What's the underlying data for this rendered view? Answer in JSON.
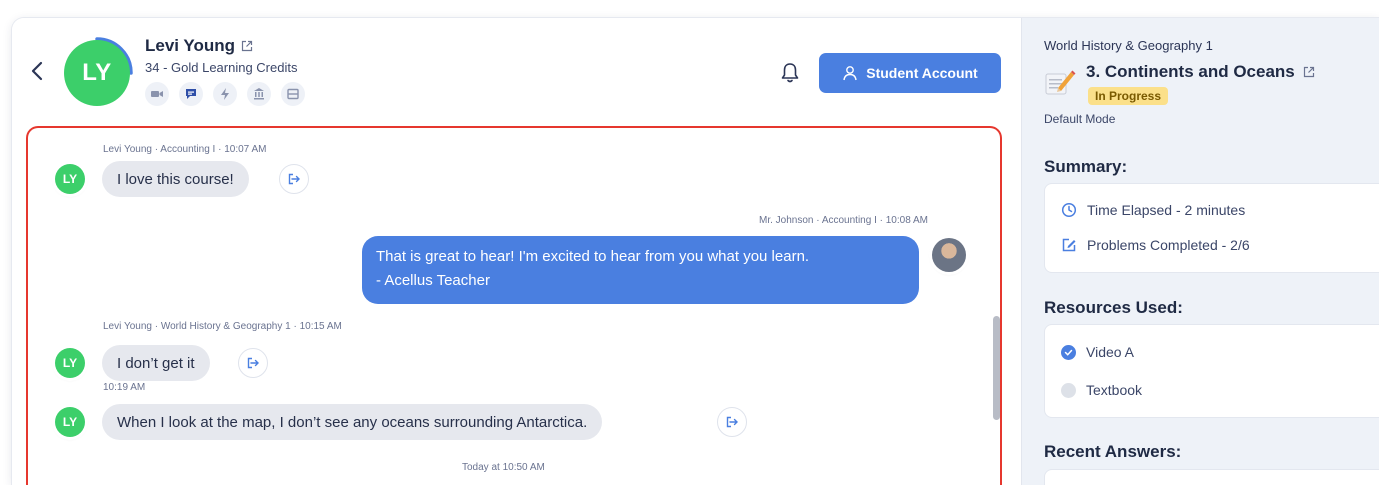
{
  "student": {
    "initials": "LY",
    "name": "Levi Young",
    "credits": "34 - Gold Learning Credits"
  },
  "header": {
    "account_button": "Student Account"
  },
  "messages": [
    {
      "meta": "Levi Young · Accounting I · 10:07 AM",
      "text": "I love this course!"
    },
    {
      "meta": "Mr. Johnson · Accounting I · 10:08 AM",
      "line1": "That is great to hear! I'm excited to hear from you what you learn.",
      "line2": "- Acellus Teacher"
    },
    {
      "meta": "Levi Young · World History & Geography 1 · 10:15 AM",
      "text": "I don’t get it"
    },
    {
      "meta": "10:19 AM",
      "text": "When I look at the map, I don’t see any oceans surrounding Antarctica."
    }
  ],
  "chat_footer": "Today at 10:50 AM",
  "panel": {
    "course": "World History & Geography 1",
    "lesson": "3. Continents and Oceans",
    "status": "In Progress",
    "mode": "Default Mode",
    "summary_heading": "Summary:",
    "summary": {
      "time": "Time Elapsed - 2 minutes",
      "problems": "Problems Completed - 2/6"
    },
    "resources_heading": "Resources Used:",
    "resources": [
      {
        "label": "Video A",
        "used": true
      },
      {
        "label": "Textbook",
        "used": false
      }
    ],
    "recent_heading": "Recent Answers:"
  },
  "colors": {
    "accent": "#4a7fe0",
    "avatar": "#3ccf6a",
    "highlight_border": "#e6372e",
    "badge": "#fbe08a"
  }
}
